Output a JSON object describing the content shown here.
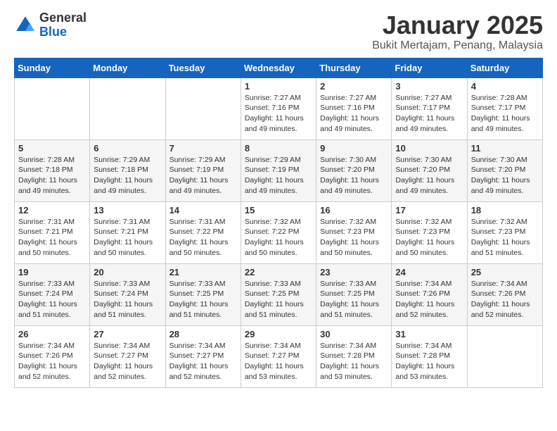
{
  "header": {
    "logo_general": "General",
    "logo_blue": "Blue",
    "title": "January 2025",
    "subtitle": "Bukit Mertajam, Penang, Malaysia"
  },
  "days_of_week": [
    "Sunday",
    "Monday",
    "Tuesday",
    "Wednesday",
    "Thursday",
    "Friday",
    "Saturday"
  ],
  "weeks": [
    [
      {
        "day": "",
        "info": ""
      },
      {
        "day": "",
        "info": ""
      },
      {
        "day": "",
        "info": ""
      },
      {
        "day": "1",
        "info": "Sunrise: 7:27 AM\nSunset: 7:16 PM\nDaylight: 11 hours\nand 49 minutes."
      },
      {
        "day": "2",
        "info": "Sunrise: 7:27 AM\nSunset: 7:16 PM\nDaylight: 11 hours\nand 49 minutes."
      },
      {
        "day": "3",
        "info": "Sunrise: 7:27 AM\nSunset: 7:17 PM\nDaylight: 11 hours\nand 49 minutes."
      },
      {
        "day": "4",
        "info": "Sunrise: 7:28 AM\nSunset: 7:17 PM\nDaylight: 11 hours\nand 49 minutes."
      }
    ],
    [
      {
        "day": "5",
        "info": "Sunrise: 7:28 AM\nSunset: 7:18 PM\nDaylight: 11 hours\nand 49 minutes."
      },
      {
        "day": "6",
        "info": "Sunrise: 7:29 AM\nSunset: 7:18 PM\nDaylight: 11 hours\nand 49 minutes."
      },
      {
        "day": "7",
        "info": "Sunrise: 7:29 AM\nSunset: 7:19 PM\nDaylight: 11 hours\nand 49 minutes."
      },
      {
        "day": "8",
        "info": "Sunrise: 7:29 AM\nSunset: 7:19 PM\nDaylight: 11 hours\nand 49 minutes."
      },
      {
        "day": "9",
        "info": "Sunrise: 7:30 AM\nSunset: 7:20 PM\nDaylight: 11 hours\nand 49 minutes."
      },
      {
        "day": "10",
        "info": "Sunrise: 7:30 AM\nSunset: 7:20 PM\nDaylight: 11 hours\nand 49 minutes."
      },
      {
        "day": "11",
        "info": "Sunrise: 7:30 AM\nSunset: 7:20 PM\nDaylight: 11 hours\nand 49 minutes."
      }
    ],
    [
      {
        "day": "12",
        "info": "Sunrise: 7:31 AM\nSunset: 7:21 PM\nDaylight: 11 hours\nand 50 minutes."
      },
      {
        "day": "13",
        "info": "Sunrise: 7:31 AM\nSunset: 7:21 PM\nDaylight: 11 hours\nand 50 minutes."
      },
      {
        "day": "14",
        "info": "Sunrise: 7:31 AM\nSunset: 7:22 PM\nDaylight: 11 hours\nand 50 minutes."
      },
      {
        "day": "15",
        "info": "Sunrise: 7:32 AM\nSunset: 7:22 PM\nDaylight: 11 hours\nand 50 minutes."
      },
      {
        "day": "16",
        "info": "Sunrise: 7:32 AM\nSunset: 7:23 PM\nDaylight: 11 hours\nand 50 minutes."
      },
      {
        "day": "17",
        "info": "Sunrise: 7:32 AM\nSunset: 7:23 PM\nDaylight: 11 hours\nand 50 minutes."
      },
      {
        "day": "18",
        "info": "Sunrise: 7:32 AM\nSunset: 7:23 PM\nDaylight: 11 hours\nand 51 minutes."
      }
    ],
    [
      {
        "day": "19",
        "info": "Sunrise: 7:33 AM\nSunset: 7:24 PM\nDaylight: 11 hours\nand 51 minutes."
      },
      {
        "day": "20",
        "info": "Sunrise: 7:33 AM\nSunset: 7:24 PM\nDaylight: 11 hours\nand 51 minutes."
      },
      {
        "day": "21",
        "info": "Sunrise: 7:33 AM\nSunset: 7:25 PM\nDaylight: 11 hours\nand 51 minutes."
      },
      {
        "day": "22",
        "info": "Sunrise: 7:33 AM\nSunset: 7:25 PM\nDaylight: 11 hours\nand 51 minutes."
      },
      {
        "day": "23",
        "info": "Sunrise: 7:33 AM\nSunset: 7:25 PM\nDaylight: 11 hours\nand 51 minutes."
      },
      {
        "day": "24",
        "info": "Sunrise: 7:34 AM\nSunset: 7:26 PM\nDaylight: 11 hours\nand 52 minutes."
      },
      {
        "day": "25",
        "info": "Sunrise: 7:34 AM\nSunset: 7:26 PM\nDaylight: 11 hours\nand 52 minutes."
      }
    ],
    [
      {
        "day": "26",
        "info": "Sunrise: 7:34 AM\nSunset: 7:26 PM\nDaylight: 11 hours\nand 52 minutes."
      },
      {
        "day": "27",
        "info": "Sunrise: 7:34 AM\nSunset: 7:27 PM\nDaylight: 11 hours\nand 52 minutes."
      },
      {
        "day": "28",
        "info": "Sunrise: 7:34 AM\nSunset: 7:27 PM\nDaylight: 11 hours\nand 52 minutes."
      },
      {
        "day": "29",
        "info": "Sunrise: 7:34 AM\nSunset: 7:27 PM\nDaylight: 11 hours\nand 53 minutes."
      },
      {
        "day": "30",
        "info": "Sunrise: 7:34 AM\nSunset: 7:28 PM\nDaylight: 11 hours\nand 53 minutes."
      },
      {
        "day": "31",
        "info": "Sunrise: 7:34 AM\nSunset: 7:28 PM\nDaylight: 11 hours\nand 53 minutes."
      },
      {
        "day": "",
        "info": ""
      }
    ]
  ]
}
